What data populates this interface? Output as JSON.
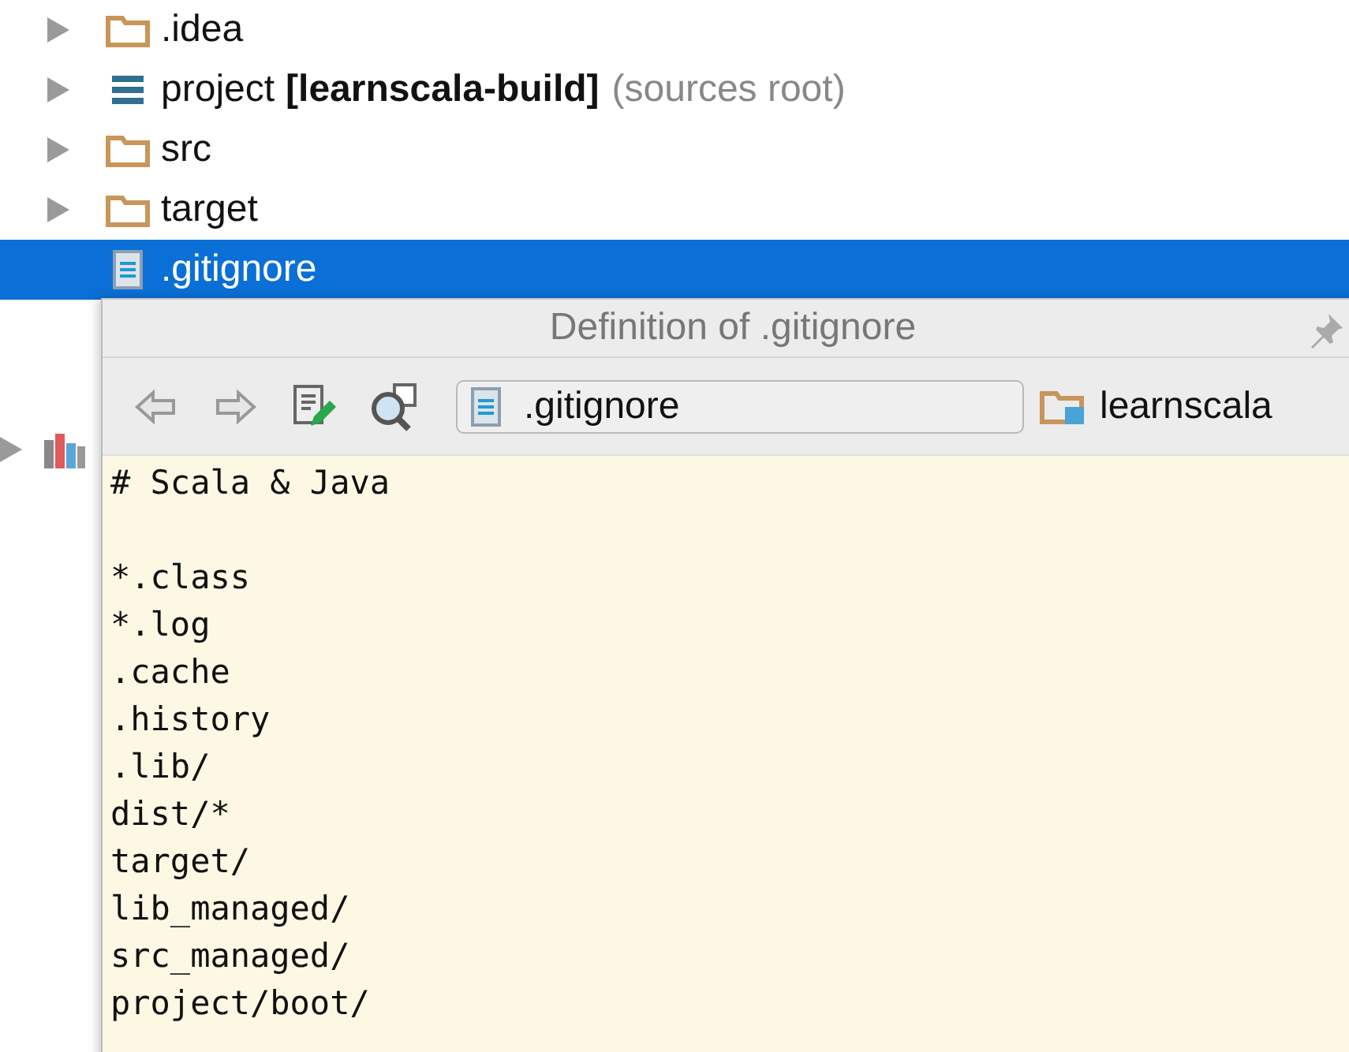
{
  "tree": {
    "items": [
      {
        "kind": "folder",
        "label": ".idea",
        "expanded": false,
        "selected": false
      },
      {
        "kind": "module",
        "label": "project",
        "bold_suffix": "[learnscala-build]",
        "hint": "(sources root)",
        "expanded": false,
        "selected": false
      },
      {
        "kind": "folder",
        "label": "src",
        "expanded": false,
        "selected": false
      },
      {
        "kind": "folder",
        "label": "target",
        "expanded": false,
        "selected": false
      },
      {
        "kind": "file",
        "label": ".gitignore",
        "selected": true
      },
      {
        "kind": "spacer"
      },
      {
        "kind": "spacer"
      },
      {
        "kind": "library",
        "expanded": false,
        "selected": false
      }
    ]
  },
  "popup": {
    "title": "Definition of .gitignore",
    "file_field": ".gitignore",
    "location": "learnscala",
    "lines": [
      {
        "kind": "text",
        "text": "# Scala & Java"
      },
      {
        "kind": "blank"
      },
      "*.class",
      "*.log",
      ".cache",
      ".history",
      ".lib/",
      "dist/*",
      "target/",
      "lib_managed/",
      "src_managed/",
      "project/boot/"
    ]
  }
}
